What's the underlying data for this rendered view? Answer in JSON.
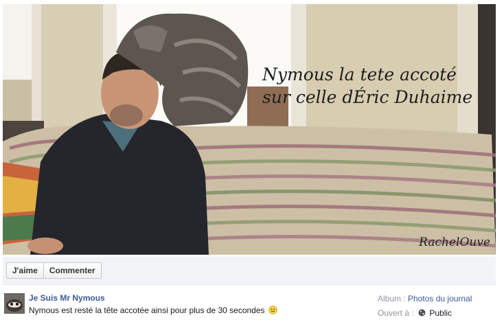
{
  "photo": {
    "caption_line1": "Nymous la tete accoté",
    "caption_line2": "sur celle dÉric Duhaime",
    "watermark": "RachelOuve"
  },
  "actions": {
    "like_label": "J'aime",
    "comment_label": "Commenter"
  },
  "post": {
    "author": "Je Suis Mr Nymous",
    "text": "Nymous est resté la tête accotée ainsi pour plus de 30 secondes",
    "album_label": "Album :",
    "album_value": "Photos du journal",
    "visibility_label": "Ouvert à :",
    "visibility_value": "Public"
  },
  "colors": {
    "link": "#3b5998",
    "action_bar_bg": "#f2f3f6"
  }
}
